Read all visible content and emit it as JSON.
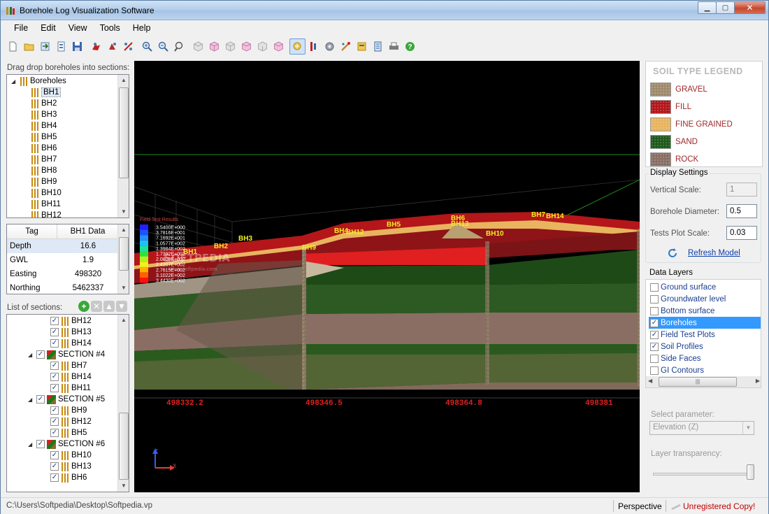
{
  "window": {
    "title": "Borehole Log Visualization Software"
  },
  "menu": [
    "File",
    "Edit",
    "View",
    "Tools",
    "Help"
  ],
  "toolbar": {
    "icons": [
      "new-file-icon",
      "open-folder-icon",
      "import-icon",
      "export-icon",
      "save-icon",
      "pan-icon",
      "rotate-icon",
      "select-icon",
      "zoom-in-icon",
      "zoom-out-icon",
      "zoom-fit-icon",
      "view-top-icon",
      "view-front-icon",
      "view-side-icon",
      "view-iso-icon",
      "view-back-icon",
      "view-bottom-icon",
      "highlight-icon",
      "grid-icon",
      "settings-icon",
      "palette-icon",
      "layers-icon",
      "report-icon",
      "print-icon",
      "help-icon"
    ]
  },
  "boreholes_panel": {
    "label": "Drag  drop boreholes into sections:",
    "root": "Boreholes",
    "items": [
      "BH1",
      "BH2",
      "BH3",
      "BH4",
      "BH5",
      "BH6",
      "BH7",
      "BH8",
      "BH9",
      "BH10",
      "BH11",
      "BH12"
    ]
  },
  "properties": {
    "col_tag": "Tag",
    "col_data": "BH1 Data",
    "rows": [
      {
        "k": "Depth",
        "v": "16.6"
      },
      {
        "k": "GWL",
        "v": "1.9"
      },
      {
        "k": "Easting",
        "v": "498320"
      },
      {
        "k": "Northing",
        "v": "5462337"
      }
    ]
  },
  "sections_panel": {
    "label": "List of sections:",
    "rows": [
      {
        "type": "bh",
        "label": "BH12"
      },
      {
        "type": "bh",
        "label": "BH13"
      },
      {
        "type": "bh",
        "label": "BH14"
      },
      {
        "type": "sec",
        "label": "SECTION #4"
      },
      {
        "type": "bh",
        "label": "BH7"
      },
      {
        "type": "bh",
        "label": "BH14"
      },
      {
        "type": "bh",
        "label": "BH11"
      },
      {
        "type": "sec",
        "label": "SECTION #5"
      },
      {
        "type": "bh",
        "label": "BH9"
      },
      {
        "type": "bh",
        "label": "BH12"
      },
      {
        "type": "bh",
        "label": "BH5"
      },
      {
        "type": "sec",
        "label": "SECTION #6"
      },
      {
        "type": "bh",
        "label": "BH10"
      },
      {
        "type": "bh",
        "label": "BH13"
      },
      {
        "type": "bh",
        "label": "BH6"
      }
    ]
  },
  "viewport": {
    "scale_title": "Field Test Results",
    "scale_values": [
      "3.5400E+000",
      "3.7816E+001",
      "7.1692E+001",
      "1.0577E+002",
      "1.3984E+002",
      "1.7392E+002",
      "2.0800E+002",
      "2.4207E+002",
      "2.7615E+002",
      "3.1022E+002",
      "3.4430E+002"
    ],
    "scale_colors": [
      "#2020ff",
      "#2050ff",
      "#2090ff",
      "#20c0ff",
      "#20e0a0",
      "#30e040",
      "#b0f020",
      "#f0f020",
      "#ffb000",
      "#ff6000",
      "#ff1010"
    ],
    "watermark": "SOFTPEDIA",
    "watermark_url": "www.softpedia.com",
    "borehole_labels": [
      {
        "t": "BH1"
      },
      {
        "t": "BH2"
      },
      {
        "t": "BH3"
      },
      {
        "t": "BH4"
      },
      {
        "t": "BH12"
      },
      {
        "t": "BH9"
      },
      {
        "t": "BH5"
      },
      {
        "t": "BH6"
      },
      {
        "t": "BH13"
      },
      {
        "t": "BH10"
      },
      {
        "t": "BH7"
      },
      {
        "t": "BH14"
      }
    ],
    "eastings": [
      "498332.2",
      "498346.5",
      "498364.8",
      "498381"
    ],
    "axis": {
      "z": "Z",
      "x": "X"
    }
  },
  "legend": {
    "title": "SOIL TYPE LEGEND",
    "items": [
      {
        "label": "GRAVEL",
        "color": "#a08a6c"
      },
      {
        "label": "FILL",
        "color": "#b4161a"
      },
      {
        "label": "FINE GRAINED",
        "color": "#e8b45e"
      },
      {
        "label": "SAND",
        "color": "#1e5a1a"
      },
      {
        "label": "ROCK",
        "color": "#8a6e64"
      }
    ]
  },
  "display_settings": {
    "title": "Display Settings",
    "vertical_scale_label": "Vertical Scale:",
    "vertical_scale_value": "1",
    "diameter_label": "Borehole Diameter:",
    "diameter_value": "0.5",
    "tests_scale_label": "Tests Plot Scale:",
    "tests_scale_value": "0.03",
    "refresh_label": "Refresh Model"
  },
  "data_layers": {
    "title": "Data Layers",
    "items": [
      {
        "label": "Ground surface",
        "checked": false
      },
      {
        "label": "Groundwater level",
        "checked": false
      },
      {
        "label": "Bottom surface",
        "checked": false
      },
      {
        "label": "Boreholes",
        "checked": true,
        "selected": true
      },
      {
        "label": "Field Test Plots",
        "checked": true
      },
      {
        "label": "Soil Profiles",
        "checked": true
      },
      {
        "label": "Side Faces",
        "checked": false
      },
      {
        "label": "GI Contours",
        "checked": false
      }
    ]
  },
  "param": {
    "label": "Select parameter:",
    "value": "Elevation (Z)"
  },
  "transparency": {
    "label": "Layer transparency:",
    "value": 1.0
  },
  "status": {
    "path": "C:\\Users\\Softpedia\\Desktop\\Softpedia.vp",
    "mode": "Perspective",
    "registration": "Unregistered Copy!"
  }
}
